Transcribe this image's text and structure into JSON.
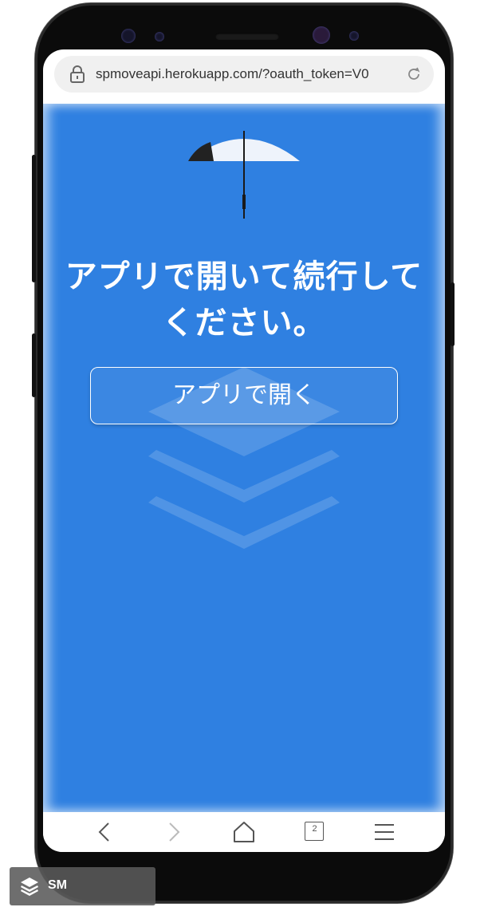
{
  "browser": {
    "url": "spmoveapi.herokuapp.com/?oauth_token=V0",
    "tab_count": "2"
  },
  "page": {
    "headline_line1": "アプリで開いて続行して",
    "headline_line2": "ください。",
    "open_button_label": "アプリで開く"
  },
  "icons": {
    "url_bar": [
      "lock-icon",
      "reload-icon"
    ],
    "nav": [
      "back-icon",
      "forward-icon",
      "home-icon",
      "tabs-icon",
      "menu-icon"
    ],
    "content": [
      "umbrella-icon",
      "layers-watermark-icon"
    ]
  },
  "colors": {
    "page_background": "#2f80e1",
    "text": "#ffffff",
    "device": "#0b0b0b"
  },
  "badge": {
    "text": "SM"
  }
}
